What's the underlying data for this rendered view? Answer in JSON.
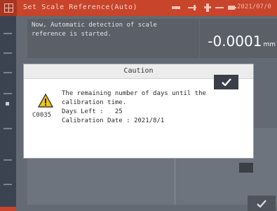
{
  "titlebar": {
    "title": "Set Scale Reference(Auto)",
    "datetime": "2021/07/0"
  },
  "message": {
    "text_line1": "Now, Automatic detection of scale",
    "text_line2": "reference is started."
  },
  "measurement": {
    "value": "-0.0001",
    "unit": "mm"
  },
  "dialog": {
    "title": "Caution",
    "error_code": "C0035",
    "line1": "The remaining number of days until the",
    "line2": "calibration time.",
    "line3": "Days Left :   25",
    "line4": "Calibration Date : 2021/8/1"
  },
  "colors": {
    "accent": "#c8442a",
    "dialog_button": "#3a3f48",
    "warning": "#f0c419"
  },
  "icons": {
    "menu": "menu-grid-icon",
    "warning": "warning-icon",
    "confirm": "check-icon"
  }
}
